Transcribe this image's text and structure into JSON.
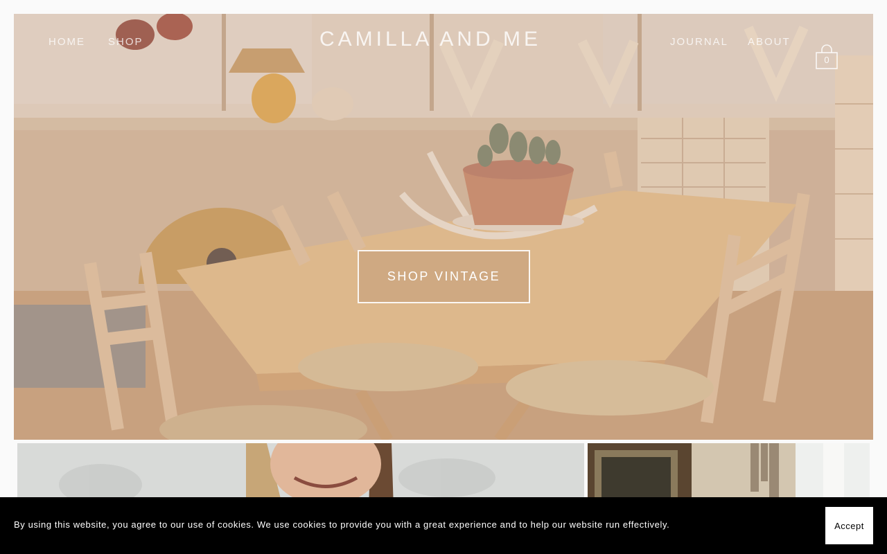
{
  "nav": {
    "left": [
      "HOME",
      "SHOP"
    ],
    "right": [
      "JOURNAL",
      "ABOUT"
    ],
    "brand": "CAMILLA AND ME",
    "cart_count": "0",
    "cart_icon": "shopping-bag-icon"
  },
  "hero": {
    "cta_label": "SHOP VINTAGE"
  },
  "cookie": {
    "message": "By using this website, you agree to our use of cookies. We use cookies to provide you with a great experience and to help our website run effectively.",
    "accept_label": "Accept"
  },
  "colors": {
    "page_background": "#fafafa",
    "cookie_background": "#000000",
    "cookie_text": "#ffffff",
    "accept_background": "#ffffff"
  }
}
